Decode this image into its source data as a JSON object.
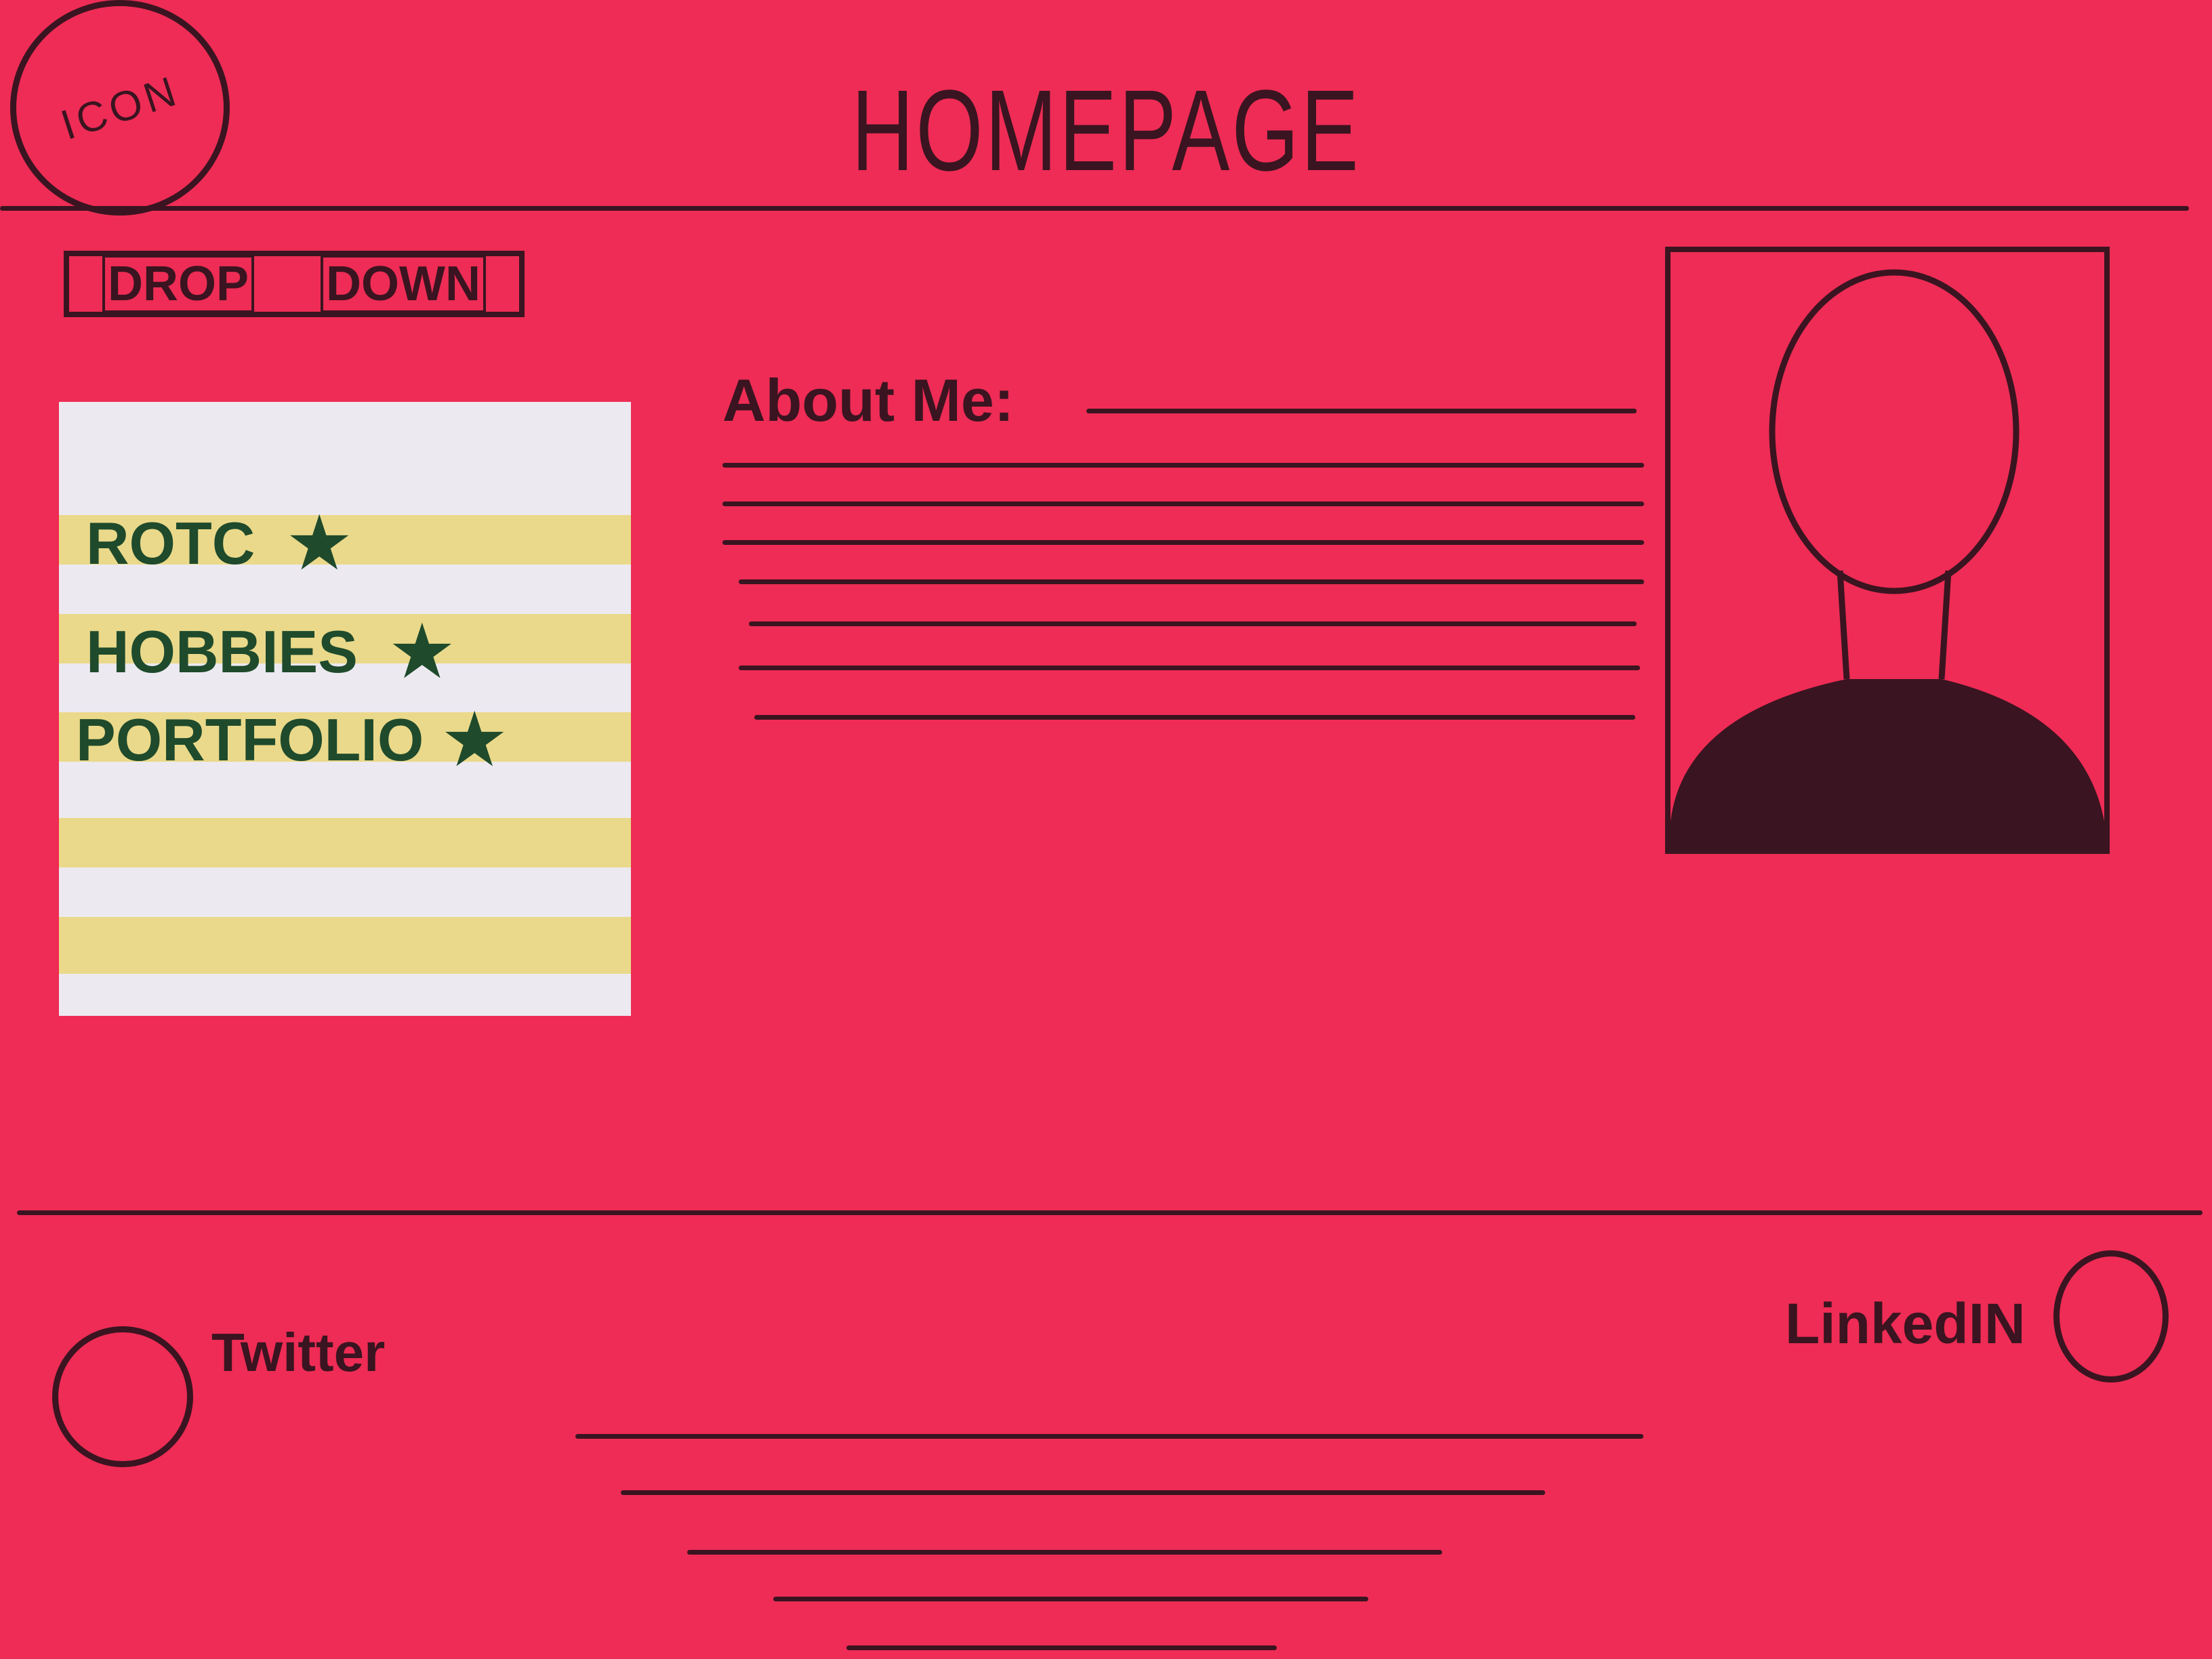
{
  "header": {
    "logo_label": "ICON",
    "title": "HOMEPAGE"
  },
  "nav": {
    "dropdown_label_1": "DROP",
    "dropdown_label_2": "DOWN"
  },
  "menu": {
    "items": [
      {
        "label": "ROTC",
        "icon": "star-icon"
      },
      {
        "label": "HOBBIES",
        "icon": "star-icon"
      },
      {
        "label": "PORTFOLIO",
        "icon": "star-icon"
      }
    ]
  },
  "about": {
    "heading": "About Me:"
  },
  "profile": {
    "icon": "person-silhouette"
  },
  "footer": {
    "twitter_label": "Twitter",
    "linkedin_label": "LinkedIN"
  },
  "colors": {
    "background": "#ee2c55",
    "ink": "#3a1420",
    "menu_bg": "#eceaf0",
    "stripe": "#ead98a",
    "menu_text": "#1f4a2c"
  }
}
